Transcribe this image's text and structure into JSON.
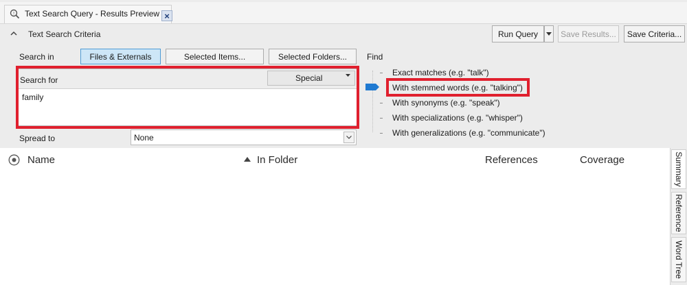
{
  "tab": {
    "title": "Text Search Query - Results Preview",
    "close_glyph": "×",
    "icon": "search-query-icon"
  },
  "criteria": {
    "title": "Text Search Criteria",
    "collapse_icon": "chevron-up-icon",
    "run_query": "Run Query",
    "run_query_dropdown_icon": "caret-down-icon",
    "save_results": "Save Results...",
    "save_criteria": "Save Criteria...",
    "search_in_label": "Search in",
    "scope_buttons": [
      "Files & Externals",
      "Selected Items...",
      "Selected Folders..."
    ],
    "selected_scope": "Files & Externals",
    "search_for_label": "Search for",
    "special_value": "Special",
    "search_text": "family",
    "spread_to_label": "Spread to",
    "spread_to_value": "None",
    "find_label": "Find",
    "find_options": [
      "Exact matches (e.g. \"talk\")",
      "With stemmed words (e.g. \"talking\")",
      "With synonyms (e.g. \"speak\")",
      "With specializations (e.g. \"whisper\")",
      "With generalizations (e.g. \"communicate\")"
    ],
    "find_selected_index": 1
  },
  "results": {
    "columns": [
      "Name",
      "In Folder",
      "References",
      "Coverage"
    ],
    "sort_column": "In Folder",
    "sort_icon": "sort-ascending-icon",
    "add_column_icon": "add-column-icon"
  },
  "side_tabs": [
    "Summary",
    "Reference",
    "Word Tree"
  ],
  "side_tabs_active": "Summary",
  "colors": {
    "highlight": "#e0202e",
    "selected_button": "#cde6f7",
    "slider_thumb": "#1f7ad1"
  }
}
